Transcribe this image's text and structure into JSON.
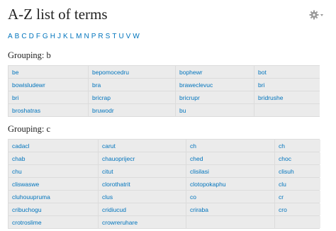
{
  "page": {
    "title": "A-Z list of terms"
  },
  "icons": {
    "settings": "gear-icon"
  },
  "alphabet": [
    "A",
    "B",
    "C",
    "D",
    "F",
    "G",
    "H",
    "J",
    "K",
    "L",
    "M",
    "N",
    "P",
    "R",
    "S",
    "T",
    "U",
    "V",
    "W"
  ],
  "groups": [
    {
      "heading": "Grouping: b",
      "rows": [
        [
          "be",
          "bepomocedru",
          "bophewr",
          "bot"
        ],
        [
          "bowisludewr",
          "bra",
          "braweclevuc",
          "bri"
        ],
        [
          "bri",
          "bricrap",
          "bricrupr",
          "bridrushe"
        ],
        [
          "broshatras",
          "bruwodr",
          "bu",
          ""
        ]
      ]
    },
    {
      "heading": "Grouping: c",
      "rows": [
        [
          "cadacl",
          "carut",
          "ch",
          "ch"
        ],
        [
          "chab",
          "chauoprijecr",
          "ched",
          "choc"
        ],
        [
          "chu",
          "citut",
          "clisilasi",
          "clisuh"
        ],
        [
          "cliswaswe",
          "clorothatrit",
          "clotopokaphu",
          "clu"
        ],
        [
          "cluhouupruma",
          "clus",
          "co",
          "cr"
        ],
        [
          "cribuchogu",
          "cridiucud",
          "criraba",
          "cro"
        ],
        [
          "crotroslime",
          "crowreruhare",
          "",
          ""
        ]
      ]
    }
  ],
  "colors": {
    "link": "#0074bd",
    "cell_bg": "#ebebeb",
    "grid_line": "#dcdcdc",
    "text": "#222222"
  }
}
